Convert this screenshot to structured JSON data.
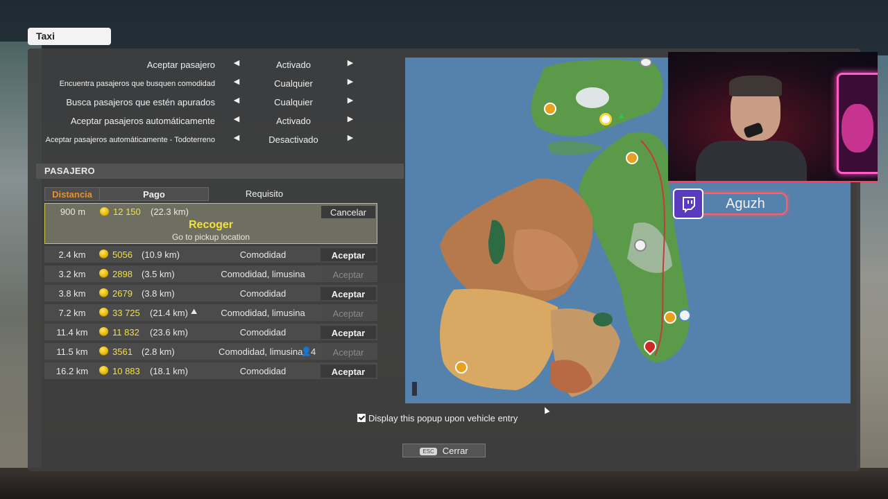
{
  "window": {
    "title": "Taxi"
  },
  "settings": [
    {
      "label": "Aceptar pasajero",
      "value": "Activado"
    },
    {
      "label": "Encuentra pasajeros que busquen comodidad",
      "value": "Cualquier"
    },
    {
      "label": "Busca pasajeros que estén apurados",
      "value": "Cualquier"
    },
    {
      "label": "Aceptar pasajeros automáticamente",
      "value": "Activado"
    },
    {
      "label": "Aceptar pasajeros automáticamente - Todoterreno",
      "value": "Desactivado"
    }
  ],
  "section": {
    "title": "PASAJERO"
  },
  "columns": {
    "distance": "Distancia",
    "payment": "Pago",
    "requirement": "Requisito"
  },
  "active": {
    "distance": "900 m",
    "amount": "12 150",
    "km": "(22.3 km)",
    "cancel_label": "Cancelar",
    "status": "Recoger",
    "instruction": "Go to pickup location"
  },
  "passengers": [
    {
      "distance": "2.4 km",
      "amount": "5056",
      "km": "(10.9 km)",
      "requirement": "Comodidad",
      "action": "Aceptar",
      "enabled": true
    },
    {
      "distance": "3.2 km",
      "amount": "2898",
      "km": "(3.5 km)",
      "requirement": "Comodidad, limusina",
      "action": "Aceptar",
      "enabled": false
    },
    {
      "distance": "3.8 km",
      "amount": "2679",
      "km": "(3.8 km)",
      "requirement": "Comodidad",
      "action": "Aceptar",
      "enabled": true
    },
    {
      "distance": "7.2 km",
      "amount": "33 725",
      "km": "(21.4 km)",
      "requirement": "Comodidad, limusina",
      "action": "Aceptar",
      "enabled": false
    },
    {
      "distance": "11.4 km",
      "amount": "11 832",
      "km": "(23.6 km)",
      "requirement": "Comodidad",
      "action": "Aceptar",
      "enabled": true
    },
    {
      "distance": "11.5 km",
      "amount": "3561",
      "km": "(2.8 km)",
      "requirement": "Comodidad, limusina,",
      "seats": "4",
      "action": "Aceptar",
      "enabled": false
    },
    {
      "distance": "16.2 km",
      "amount": "10 883",
      "km": "(18.1 km)",
      "requirement": "Comodidad",
      "action": "Aceptar",
      "enabled": true
    }
  ],
  "popup_toggle": {
    "label": "Display this popup upon vehicle entry",
    "checked": true
  },
  "close": {
    "key": "ESC",
    "label": "Cerrar"
  },
  "stream_overlay": {
    "username": "Aguzh"
  },
  "colors": {
    "accent_orange": "#e9902a",
    "money_yellow": "#f2e23a",
    "active_border": "#c8c84a",
    "map_water": "#5582ad",
    "twitch_purple": "#5b3bbd"
  }
}
